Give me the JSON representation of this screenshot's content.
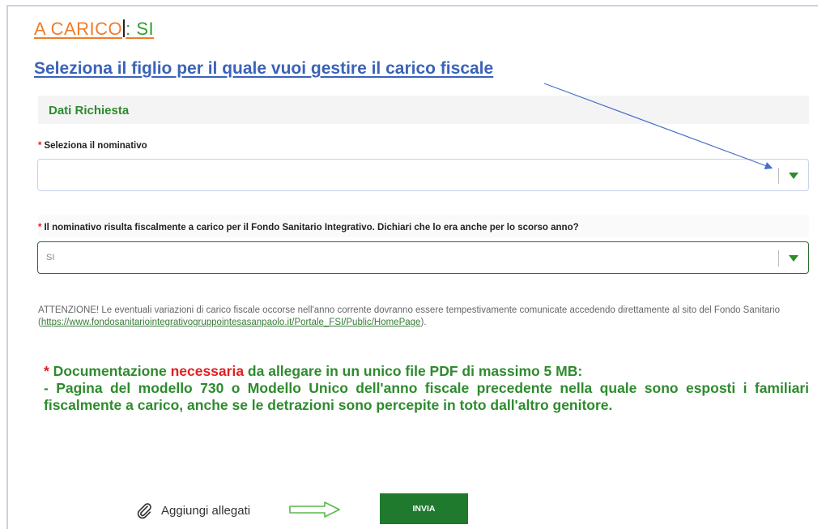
{
  "header": {
    "title_prefix": "A CARICO",
    "title_value": ": SI",
    "subtitle": "Seleziona il figlio per il quale vuoi gestire il carico fiscale"
  },
  "section": {
    "title": "Dati Richiesta"
  },
  "nominativo": {
    "required_mark": "*",
    "label": "Seleziona il nominativo",
    "value": ""
  },
  "question": {
    "required_mark": "*",
    "label": "Il nominativo risulta fiscalmente a carico per il Fondo Sanitario Integrativo. Dichiari che lo era anche per lo scorso anno?",
    "value": "SI"
  },
  "notice": {
    "text_before": "ATTENZIONE! Le eventuali variazioni di carico fiscale occorse nell'anno corrente dovranno essere tempestivamente comunicate accedendo direttamente al sito del Fondo Sanitario (",
    "link": "https://www.fondosanitariointegrativogruppointesasanpaolo.it/Portale_FSI/Public/HomePage",
    "text_after": ")."
  },
  "documents": {
    "star": "*",
    "line1_a": " Documentazione ",
    "line1_red": "necessaria",
    "line1_b": " da allegare in un unico file PDF di massimo 5 MB:",
    "line2": "- Pagina del modello 730 o Modello Unico dell'anno fiscale precedente nella quale sono esposti i familiari fiscalmente a carico, anche se le detrazioni sono percepite in toto dall'altro genitore."
  },
  "actions": {
    "attach_label": "Aggiungi allegati",
    "send_label": "INVIA"
  },
  "colors": {
    "orange": "#f07d2a",
    "green": "#2e8b2e",
    "blue": "#3a63b8",
    "red": "#e02020",
    "button_green": "#1f7a2e"
  },
  "icons": [
    "paperclip-icon",
    "right-arrow-icon",
    "chevron-down-icon"
  ]
}
